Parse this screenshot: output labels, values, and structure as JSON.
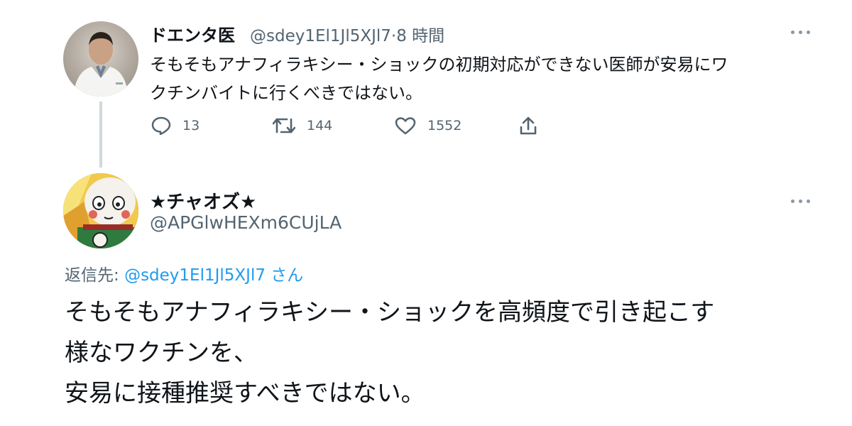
{
  "tweet1": {
    "name": "ドエンタ医",
    "handle": "@sdey1El1Jl5XJl7",
    "time": "·8 時間",
    "lines": [
      "そもそもアナフィラキシー・ショックの初期対応ができない医師が安易にワ",
      "クチンバイトに行くべきではない。"
    ],
    "reply_count": "13",
    "retweet_count": "144",
    "like_count": "1552"
  },
  "tweet2": {
    "name": "★チャオズ★",
    "handle": "@APGlwHEXm6CUjLA",
    "reply_to_label": "返信先: ",
    "reply_to_handle": "@sdey1El1Jl5XJl7",
    "reply_to_suffix": " さん",
    "lines": [
      "そもそもアナフィラキシー・ショックを高頻度で引き起こす",
      "様なワクチンを、",
      "安易に接種推奨すべきではない。"
    ]
  },
  "colors": {
    "text": "#0f1419",
    "secondary": "#536471",
    "link": "#1d9bf0",
    "thread_line": "#cfd9de"
  },
  "icons": [
    "more-icon",
    "reply-icon",
    "retweet-icon",
    "like-icon",
    "share-icon"
  ]
}
